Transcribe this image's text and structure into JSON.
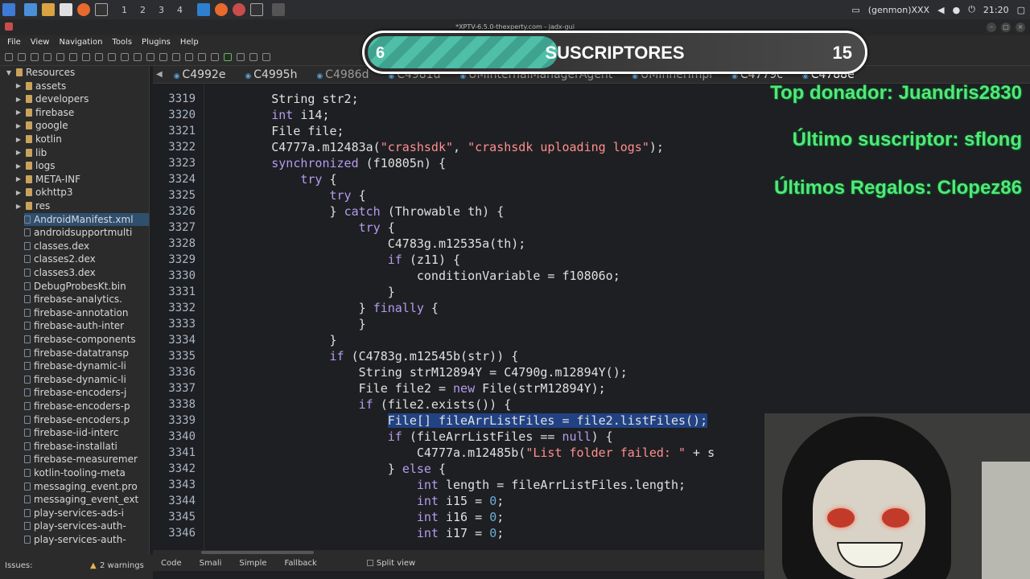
{
  "window": {
    "title": "*XPTV-6.5.0-thexperty.com - jadx-gui"
  },
  "taskbar": {
    "workspaces": [
      "1",
      "2",
      "3",
      "4"
    ],
    "user": "(genmon)XXX",
    "clock": "21:20"
  },
  "menu": [
    "File",
    "View",
    "Navigation",
    "Tools",
    "Plugins",
    "Help"
  ],
  "sidebar": {
    "root": "Resources",
    "folders": [
      "assets",
      "developers",
      "firebase",
      "google",
      "kotlin",
      "lib",
      "logs",
      "META-INF",
      "okhttp3",
      "res"
    ],
    "files": [
      "AndroidManifest.xml",
      "androidsupportmulti",
      "classes.dex",
      "classes2.dex",
      "classes3.dex",
      "DebugProbesKt.bin",
      "firebase-analytics.",
      "firebase-annotation",
      "firebase-auth-inter",
      "firebase-components",
      "firebase-datatransp",
      "firebase-dynamic-li",
      "firebase-dynamic-li",
      "firebase-encoders-j",
      "firebase-encoders-p",
      "firebase-encoders.p",
      "firebase-iid-interc",
      "firebase-installati",
      "firebase-measuremer",
      "kotlin-tooling-meta",
      "messaging_event.pro",
      "messaging_event_ext",
      "play-services-ads-i",
      "play-services-auth-",
      "play-services-auth-"
    ],
    "selected_file": "AndroidManifest.xml"
  },
  "tabs": [
    "C4992e",
    "C4995h",
    "C4986d",
    "C4981d",
    "UMInternalManagerAgent",
    "UMInnerImpl",
    "C4779c",
    "C4788e"
  ],
  "active_tab": "C4788e",
  "code": {
    "lines": [
      {
        "n": "3319",
        "t": "        String str2;"
      },
      {
        "n": "3320",
        "t": "        int i14;"
      },
      {
        "n": "3321",
        "t": "        File file;"
      },
      {
        "n": "3322",
        "t": "        C4777a.m12483a(\"crashsdk\", \"crashsdk uploading logs\");"
      },
      {
        "n": "3323",
        "t": "        synchronized (f10805n) {"
      },
      {
        "n": "3324",
        "t": "            try {"
      },
      {
        "n": "3325",
        "t": "                try {"
      },
      {
        "n": "3326",
        "t": "                } catch (Throwable th) {"
      },
      {
        "n": "3327",
        "t": "                    try {"
      },
      {
        "n": "3328",
        "t": "                        C4783g.m12535a(th);"
      },
      {
        "n": "3329",
        "t": "                        if (z11) {"
      },
      {
        "n": "3330",
        "t": "                            conditionVariable = f10806o;"
      },
      {
        "n": "3331",
        "t": "                        }"
      },
      {
        "n": "3332",
        "t": "                    } finally {"
      },
      {
        "n": "3333",
        "t": "                    }"
      },
      {
        "n": "3334",
        "t": "                }"
      },
      {
        "n": "3335",
        "t": "                if (C4783g.m12545b(str)) {"
      },
      {
        "n": "3336",
        "t": "                    String strM12894Y = C4790g.m12894Y();"
      },
      {
        "n": "3337",
        "t": "                    File file2 = new File(strM12894Y);"
      },
      {
        "n": "3338",
        "t": "                    if (file2.exists()) {"
      },
      {
        "n": "3339",
        "t": "                        File[] fileArrListFiles = file2.listFiles();"
      },
      {
        "n": "3340",
        "t": "                        if (fileArrListFiles == null) {"
      },
      {
        "n": "3341",
        "t": "                            C4777a.m12485b(\"List folder failed: \" + s"
      },
      {
        "n": "3342",
        "t": "                        } else {"
      },
      {
        "n": "3343",
        "t": "                            int length = fileArrListFiles.length;"
      },
      {
        "n": "3344",
        "t": "                            int i15 = 0;"
      },
      {
        "n": "3345",
        "t": "                            int i16 = 0;"
      },
      {
        "n": "3346",
        "t": "                            int i17 = 0;"
      }
    ],
    "highlighted_line": "3339"
  },
  "modes": [
    "Code",
    "Smali",
    "Simple",
    "Fallback"
  ],
  "split_view": "Split view",
  "status": {
    "issues": "Issues:",
    "warnings": "2 warnings"
  },
  "overlay": {
    "subs_left": "6",
    "subs_label": "SUSCRIPTORES",
    "subs_right": "15",
    "subs_progress": 0.38,
    "top_donor": "Top donador: Juandris2830",
    "last_sub": "Último suscriptor: sflong",
    "last_gifts": "Últimos Regalos: Clopez86"
  },
  "colors": {
    "keyword": "#b59bef",
    "string": "#ff8f8f",
    "number": "#6aaed6",
    "selection": "#214283",
    "overlay_text": "#53e878"
  }
}
